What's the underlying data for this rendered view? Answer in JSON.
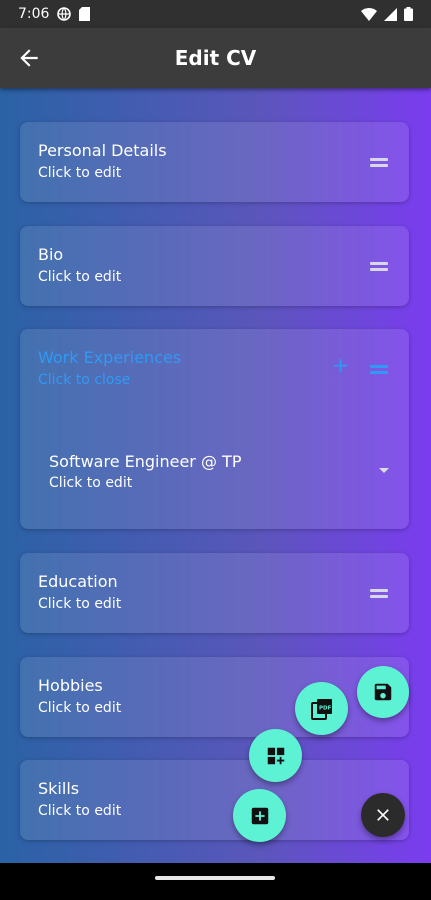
{
  "status_bar": {
    "time": "7:06"
  },
  "app_bar": {
    "title": "Edit CV"
  },
  "sections": [
    {
      "title": "Personal Details",
      "subtitle": "Click to edit"
    },
    {
      "title": "Bio",
      "subtitle": "Click to edit"
    },
    {
      "title": "Work Experiences",
      "subtitle": "Click to close",
      "add": "+",
      "items": [
        {
          "title": "Software Engineer @ TP",
          "subtitle": "Click to edit"
        }
      ]
    },
    {
      "title": "Education",
      "subtitle": "Click to edit"
    },
    {
      "title": "Hobbies",
      "subtitle": "Click to edit"
    },
    {
      "title": "Skills",
      "subtitle": "Click to edit"
    }
  ],
  "fabs": {
    "save_icon": "save-icon",
    "pdf_icon": "pdf-icon",
    "add_section_icon": "dashboard-add-icon",
    "add_item_icon": "add-box-icon",
    "close_icon": "close-icon"
  },
  "colors": {
    "accent": "#2f9af5",
    "fab": "#5ef2d5",
    "gradient_start": "#2a62a5",
    "gradient_end": "#7b3cf0"
  }
}
